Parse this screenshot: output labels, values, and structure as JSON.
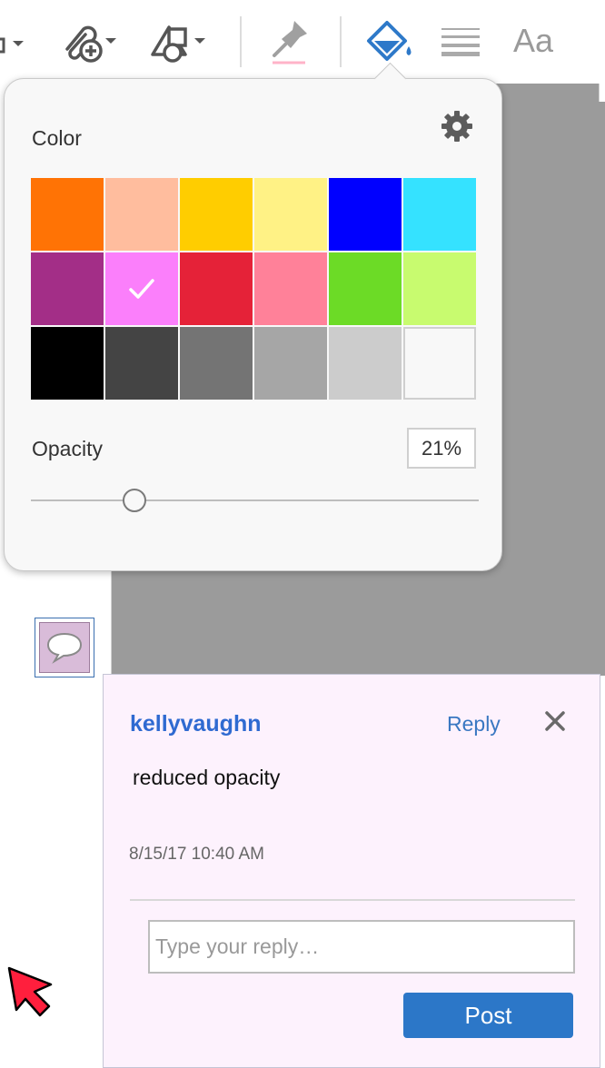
{
  "toolbar": {
    "tools": [
      {
        "icon": "stamp-icon"
      },
      {
        "icon": "attach-file-icon"
      },
      {
        "icon": "shapes-icon"
      },
      {
        "icon": "pin-icon"
      },
      {
        "icon": "fill-color-icon",
        "active": true
      },
      {
        "icon": "line-weight-icon"
      },
      {
        "icon": "text-properties-icon",
        "label": "Aa"
      }
    ]
  },
  "color_popover": {
    "title": "Color",
    "settings_icon": "gear-icon",
    "swatches": [
      "#ff7305",
      "#ffbd9e",
      "#ffcd00",
      "#fff285",
      "#0000ff",
      "#35e2ff",
      "#a32e87",
      "#fb7ffb",
      "#e52238",
      "#ff8199",
      "#6cdb26",
      "#c8fb6f",
      "#000000",
      "#444444",
      "#747474",
      "#a6a6a6",
      "#cccccc",
      "#f8f8f8"
    ],
    "selected_index": 7,
    "opacity_label": "Opacity",
    "opacity_value": "21%",
    "opacity_fraction": 0.23
  },
  "comment": {
    "author": "kellyvaughn",
    "reply_label": "Reply",
    "text": "reduced opacity",
    "date": "8/15/17  10:40 AM",
    "reply_placeholder": "Type your reply…",
    "post_label": "Post"
  },
  "colors": {
    "accent": "#2c77c8",
    "comment_bg": "#fdf2fd",
    "note_icon_bg": "#d9bcd9",
    "canvas_gray": "#9b9b9b",
    "cursor_red": "#ff1f3d"
  }
}
